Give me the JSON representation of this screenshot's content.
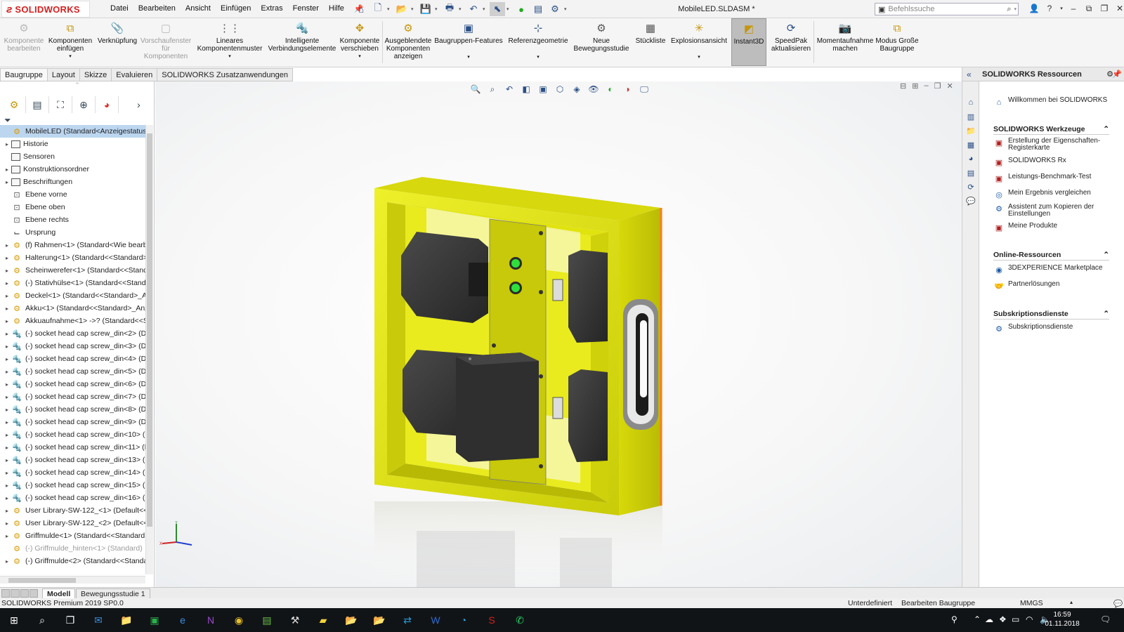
{
  "app": {
    "brand_ds": "3S",
    "brand_name": "SOLIDWORKS",
    "doc_title": "MobileLED.SLDASM *"
  },
  "menu": [
    "Datei",
    "Bearbeiten",
    "Ansicht",
    "Einfügen",
    "Extras",
    "Fenster",
    "Hilfe"
  ],
  "search": {
    "placeholder": "Befehlssuche"
  },
  "ribbon": [
    {
      "label": "Komponente bearbeiten",
      "disabled": true
    },
    {
      "label": "Komponenten einfügen",
      "disabled": false
    },
    {
      "label": "Verknüpfung",
      "disabled": false
    },
    {
      "label": "Vorschaufenster für Komponenten",
      "disabled": true
    },
    {
      "label": "Lineares Komponentenmuster",
      "disabled": false
    },
    {
      "label": "Intelligente Verbindungselemente",
      "disabled": false
    },
    {
      "label": "Komponente verschieben",
      "disabled": false
    },
    {
      "label": "Ausgeblendete Komponenten anzeigen",
      "disabled": false
    },
    {
      "label": "Baugruppen-Features",
      "disabled": false
    },
    {
      "label": "Referenzgeometrie",
      "disabled": false
    },
    {
      "label": "Neue Bewegungsstudie",
      "disabled": false
    },
    {
      "label": "Stückliste",
      "disabled": false
    },
    {
      "label": "Explosionsansicht",
      "disabled": false
    },
    {
      "label": "Instant3D",
      "disabled": false,
      "active": true
    },
    {
      "label": "SpeedPak aktualisieren",
      "disabled": false
    },
    {
      "label": "Momentaufnahme machen",
      "disabled": false
    },
    {
      "label": "Modus Große Baugruppe",
      "disabled": false
    }
  ],
  "tabs": [
    "Baugruppe",
    "Layout",
    "Skizze",
    "Evaluieren",
    "SOLIDWORKS Zusatzanwendungen"
  ],
  "tree": [
    {
      "label": "MobileLED  (Standard<Anzeigestatus-1>)",
      "icon": "assembly",
      "exp": "",
      "root": true
    },
    {
      "label": "Historie",
      "icon": "folder",
      "exp": "▸"
    },
    {
      "label": "Sensoren",
      "icon": "folder",
      "exp": ""
    },
    {
      "label": "Konstruktionsordner",
      "icon": "folder",
      "exp": "▸"
    },
    {
      "label": "Beschriftungen",
      "icon": "folder",
      "exp": "▸"
    },
    {
      "label": "Ebene vorne",
      "icon": "plane",
      "exp": ""
    },
    {
      "label": "Ebene oben",
      "icon": "plane",
      "exp": ""
    },
    {
      "label": "Ebene rechts",
      "icon": "plane",
      "exp": ""
    },
    {
      "label": "Ursprung",
      "icon": "origin",
      "exp": ""
    },
    {
      "label": "(f) Rahmen<1> (Standard<Wie bearbe",
      "icon": "part",
      "exp": "▸"
    },
    {
      "label": "Halterung<1> (Standard<<Standard>",
      "icon": "part",
      "exp": "▸"
    },
    {
      "label": "Scheinwerefer<1> (Standard<<Standa",
      "icon": "part",
      "exp": "▸"
    },
    {
      "label": "(-) Stativhülse<1> (Standard<<Standa",
      "icon": "part",
      "exp": "▸"
    },
    {
      "label": "Deckel<1> (Standard<<Standard>_Ar",
      "icon": "part",
      "exp": "▸"
    },
    {
      "label": "Akku<1> (Standard<<Standard>_Anz",
      "icon": "part",
      "exp": "▸"
    },
    {
      "label": "Akkuaufnahme<1> ->? (Standard<<S",
      "icon": "part",
      "exp": "▸"
    },
    {
      "label": "(-) socket head cap screw_din<2> (DII",
      "icon": "screw",
      "exp": "▸"
    },
    {
      "label": "(-) socket head cap screw_din<3> (DII",
      "icon": "screw",
      "exp": "▸"
    },
    {
      "label": "(-) socket head cap screw_din<4> (DII",
      "icon": "screw",
      "exp": "▸"
    },
    {
      "label": "(-) socket head cap screw_din<5> (DII",
      "icon": "screw",
      "exp": "▸"
    },
    {
      "label": "(-) socket head cap screw_din<6> (DII",
      "icon": "screw",
      "exp": "▸"
    },
    {
      "label": "(-) socket head cap screw_din<7> (DII",
      "icon": "screw",
      "exp": "▸"
    },
    {
      "label": "(-) socket head cap screw_din<8> (DII",
      "icon": "screw",
      "exp": "▸"
    },
    {
      "label": "(-) socket head cap screw_din<9> (DII",
      "icon": "screw",
      "exp": "▸"
    },
    {
      "label": "(-) socket head cap screw_din<10> (D",
      "icon": "screw",
      "exp": "▸"
    },
    {
      "label": "(-) socket head cap screw_din<11> (D",
      "icon": "screw",
      "exp": "▸"
    },
    {
      "label": "(-) socket head cap screw_din<13> (D",
      "icon": "screw",
      "exp": "▸"
    },
    {
      "label": "(-) socket head cap screw_din<14> (D",
      "icon": "screw",
      "exp": "▸"
    },
    {
      "label": "(-) socket head cap screw_din<15> (D",
      "icon": "screw",
      "exp": "▸"
    },
    {
      "label": "(-) socket head cap screw_din<16> (D",
      "icon": "screw",
      "exp": "▸"
    },
    {
      "label": "User Library-SW-122_<1> (Default<<[",
      "icon": "part",
      "exp": "▸"
    },
    {
      "label": "User Library-SW-122_<2> (Default<<[",
      "icon": "part",
      "exp": "▸"
    },
    {
      "label": "Griffmulde<1> (Standard<<Standard:",
      "icon": "part",
      "exp": "▸"
    },
    {
      "label": "(-) Griffmulde_hinten<1> (Standard)",
      "icon": "part",
      "exp": "",
      "dim": true
    },
    {
      "label": "(-) Griffmulde<2> (Standard<<Standa",
      "icon": "part",
      "exp": "▸"
    }
  ],
  "bottom_tabs": {
    "model": "Modell",
    "motion": "Bewegungsstudie 1"
  },
  "status": {
    "product": "SOLIDWORKS Premium 2019 SP0.0",
    "state": "Unterdefiniert",
    "mode": "Bearbeiten Baugruppe",
    "units": "MMGS"
  },
  "taskpane": {
    "title": "SOLIDWORKS Ressourcen",
    "welcome": "Willkommen bei SOLIDWORKS",
    "sections": [
      {
        "title": "SOLIDWORKS Werkzeuge",
        "items": [
          "Erstellung der Eigenschaften-Registerkarte",
          "SOLIDWORKS Rx",
          "Leistungs-Benchmark-Test",
          "Mein Ergebnis vergleichen",
          "Assistent zum Kopieren der Einstellungen",
          "Meine Produkte"
        ]
      },
      {
        "title": "Online-Ressourcen",
        "items": [
          "3DEXPERIENCE Marketplace",
          "Partnerlösungen"
        ]
      },
      {
        "title": "Subskriptionsdienste",
        "items": [
          "Subskriptionsdienste"
        ]
      }
    ]
  },
  "clock": {
    "time": "16:59",
    "date": "01.11.2018"
  },
  "colors": {
    "frame_yellow": "#e6e80a",
    "led_green": "#2fe03a",
    "tree_selected": "#bcd6f0",
    "brand_red": "#d42020"
  }
}
